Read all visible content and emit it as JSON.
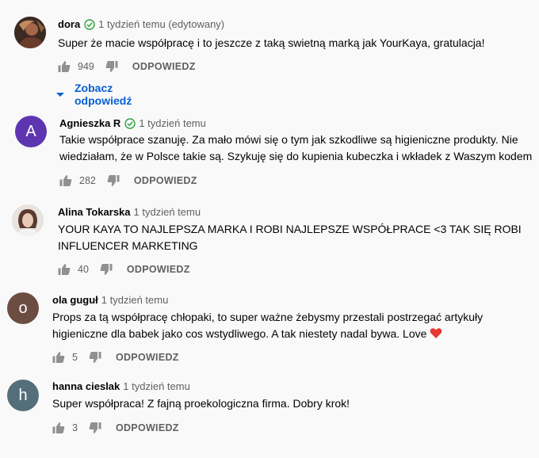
{
  "colors": {
    "link": "#065fd4",
    "secondary_text": "#606060",
    "verified": "#2ba640",
    "avatar_agnieszka": "#5e35b1",
    "avatar_ola": "#6d4c41",
    "avatar_hanna": "#546e7a",
    "heart": "#e53935"
  },
  "comments": [
    {
      "author": "dora",
      "time": "1 tydzień temu (edytowany)",
      "verified": true,
      "text": "Super że macie współpracę i to jeszcze z taką swietną marką jak YourKaya, gratulacja!",
      "likes": "949",
      "reply": "ODPOWIEDZ",
      "view_replies": "Zobacz odpowiedź",
      "avatar_icon": "photo-avatar"
    },
    {
      "author": "Agnieszka R",
      "time": "1 tydzień temu",
      "verified": true,
      "avatar_letter": "A",
      "text_lines": [
        "Takie współprace szanuję. Za mało mówi się o tym jak szkodliwe są higieniczne produkty. Nie",
        "wiedziałam, że w Polsce takie są. Szykuję się do kupienia kubeczka i wkładek z Waszym kodem"
      ],
      "likes": "282",
      "reply": "ODPOWIEDZ"
    },
    {
      "author": "Alina Tokarska",
      "time": "1 tydzień temu",
      "verified": false,
      "avatar_icon": "photo-avatar",
      "text_lines": [
        "YOUR KAYA TO NAJLEPSZA MARKA I ROBI NAJLEPSZE WSPÓŁPRACE <3 TAK SIĘ ROBI",
        "INFLUENCER MARKETING"
      ],
      "likes": "40",
      "reply": "ODPOWIEDZ"
    },
    {
      "author": "ola guguł",
      "time": "1 tydzień temu",
      "verified": false,
      "avatar_letter": "o",
      "text_lines": [
        "Props za tą współpracę chłopaki, to super ważne żebysmy przestali postrzegać artykuły",
        "higieniczne dla babek jako cos wstydliwego. A tak niestety nadal bywa. Love"
      ],
      "likes": "5",
      "reply": "ODPOWIEDZ"
    },
    {
      "author": "hanna cieslak",
      "time": "1 tydzień temu",
      "verified": false,
      "avatar_letter": "h",
      "text": "Super współpraca! Z fajną proekologiczna firma. Dobry krok!",
      "likes": "3",
      "reply": "ODPOWIEDZ"
    }
  ]
}
